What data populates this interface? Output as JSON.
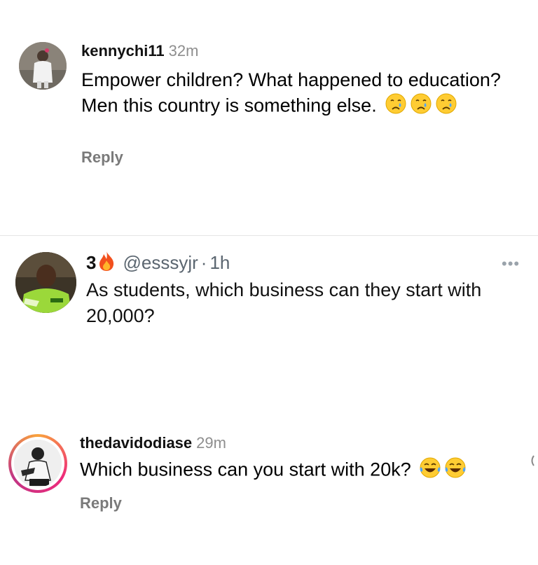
{
  "comments": [
    {
      "username": "kennychi11",
      "time": "32m",
      "text": "Empower children? What happened to education?  Men this country is something else.",
      "emoji_icons": [
        "crying-face-icon",
        "crying-face-icon",
        "crying-face-icon"
      ],
      "reply_label": "Reply"
    },
    {
      "count": "3",
      "count_icon": "fire-icon",
      "handle": "@esssyjr",
      "separator": "·",
      "time": "1h",
      "text": "As students, which business can they start with 20,000?",
      "more_icon": "more-options-icon"
    },
    {
      "username": "thedavidodiase",
      "time": "29m",
      "text": "Which business can you start with 20k?",
      "emoji_icons": [
        "tears-of-joy-icon",
        "tears-of-joy-icon"
      ],
      "reply_label": "Reply"
    }
  ],
  "colors": {
    "secondary_text": "#8e8e8e",
    "story_ring": [
      "#f9a33c",
      "#ee2a7b",
      "#c13584"
    ]
  }
}
